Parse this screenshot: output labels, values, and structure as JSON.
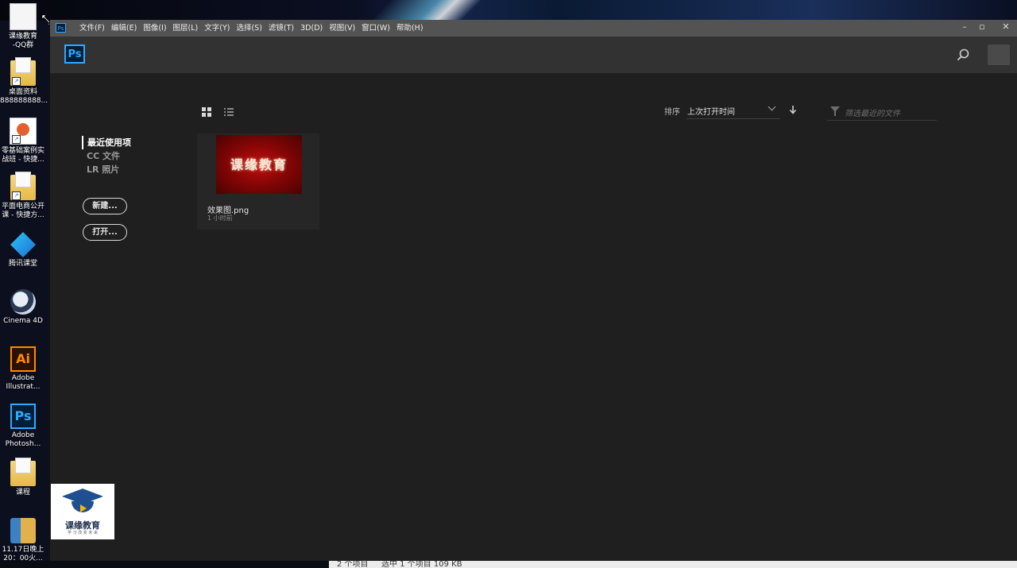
{
  "desktop": {
    "icons": [
      {
        "label": "课缘教育\n-QQ群",
        "icon": "document-icon"
      },
      {
        "label": "桌面资料\n888888888...",
        "icon": "folder-icon"
      },
      {
        "label": "零基础案例实\n战班 - 快捷...",
        "icon": "presentation-file-icon"
      },
      {
        "label": "平面电商公开\n课 - 快捷方...",
        "icon": "folder-icon"
      },
      {
        "label": "腾讯课堂",
        "icon": "tencent-classroom-icon"
      },
      {
        "label": "Cinema 4D",
        "icon": "cinema4d-icon"
      },
      {
        "label": "Adobe\nIllustrat...",
        "icon": "illustrator-icon",
        "glyph": "Ai"
      },
      {
        "label": "Adobe\nPhotosh...",
        "icon": "photoshop-icon",
        "glyph": "Ps"
      },
      {
        "label": "课程",
        "icon": "folder-icon"
      },
      {
        "label": "11.17日晚上\n20：00火...",
        "icon": "archive-icon"
      }
    ],
    "shortcut_glyph": "↗",
    "bottom_status": {
      "items": "2 个项目",
      "selected": "选中 1 个项目  109 KB"
    }
  },
  "watermark": {
    "text": "课缘教育",
    "sub": "学 习 改 变 未 来"
  },
  "window": {
    "app_icon": "Ps",
    "menus": [
      "文件(F)",
      "编辑(E)",
      "图像(I)",
      "图层(L)",
      "文字(Y)",
      "选择(S)",
      "滤镜(T)",
      "3D(D)",
      "视图(V)",
      "窗口(W)",
      "帮助(H)"
    ],
    "controls": {
      "minimize": "–",
      "maximize": "▫",
      "close": "✕"
    }
  },
  "header": {
    "logo": "Ps"
  },
  "sidebar": {
    "items": [
      {
        "label": "最近使用项",
        "active": true
      },
      {
        "label": "CC 文件",
        "active": false
      },
      {
        "label": "LR 照片",
        "active": false
      }
    ],
    "new_button": "新建...",
    "open_button": "打开..."
  },
  "toolbar": {
    "sort_label": "排序",
    "sort_value": "上次打开时间",
    "filter_placeholder": "筛选最近的文件"
  },
  "files": [
    {
      "name": "效果图.png",
      "time": "1 小时前",
      "thumb_text": "课缘教育"
    }
  ],
  "colors": {
    "ps_blue": "#31a8ff",
    "ps_dark": "#001e36",
    "bg": "#1f1f1f",
    "header": "#323232"
  }
}
